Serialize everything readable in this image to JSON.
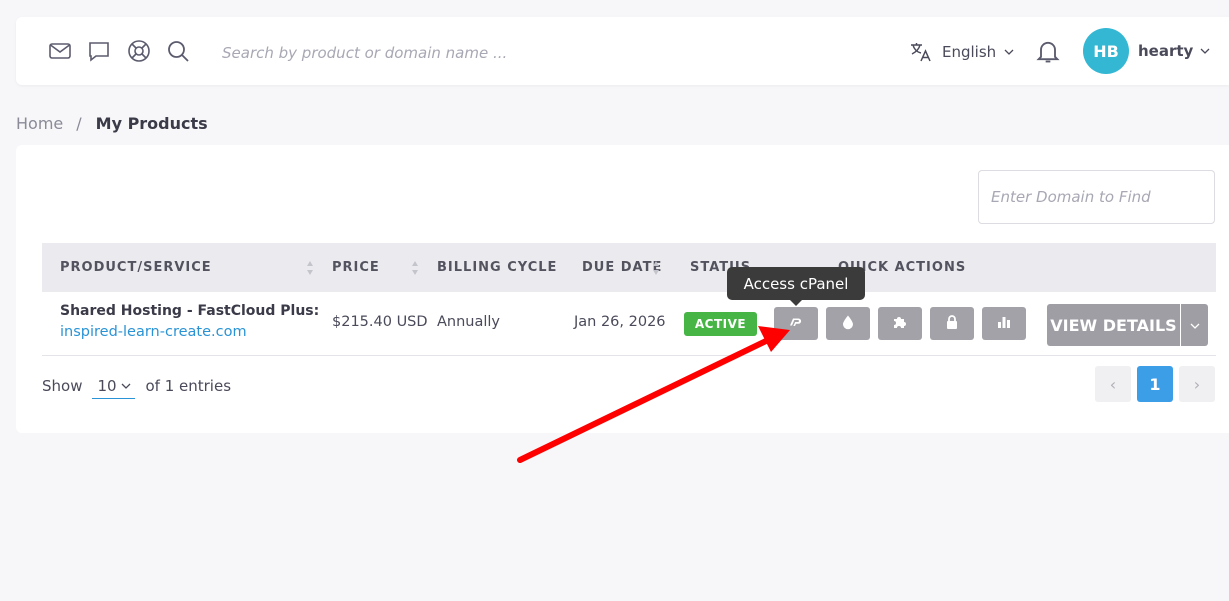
{
  "header": {
    "search_placeholder": "Search by product or domain name ...",
    "language": "English",
    "avatar_initials": "HB",
    "username": "hearty",
    "icons": [
      "mail-icon",
      "chat-icon",
      "lifebuoy-icon",
      "search-icon",
      "translate-icon",
      "bell-icon"
    ]
  },
  "breadcrumb": {
    "home": "Home",
    "separator": "/",
    "current": "My Products"
  },
  "products": {
    "find_placeholder": "Enter Domain to Find",
    "columns": [
      "PRODUCT/SERVICE",
      "PRICE",
      "BILLING CYCLE",
      "DUE DATE",
      "STATUS",
      "QUICK ACTIONS"
    ],
    "rows": [
      {
        "name": "Shared Hosting - FastCloud Plus:",
        "domain": "inspired-learn-create.com",
        "price": "$215.40 USD",
        "billing_cycle": "Annually",
        "due_date": "Jan 26, 2026",
        "status": "ACTIVE",
        "view_details": "VIEW DETAILS"
      }
    ],
    "quick_action_icons": [
      "cpanel-icon",
      "drop-icon",
      "puzzle-icon",
      "lock-icon",
      "stats-icon"
    ],
    "tooltip": "Access cPanel",
    "show_label": "Show",
    "page_size": "10",
    "entries_label": "of 1 entries",
    "current_page": "1",
    "prev": "‹",
    "next": "›"
  },
  "colors": {
    "accent": "#2a93d5",
    "active": "#47b545",
    "avatar": "#33b7d3",
    "annotation_arrow": "#ff0000"
  }
}
